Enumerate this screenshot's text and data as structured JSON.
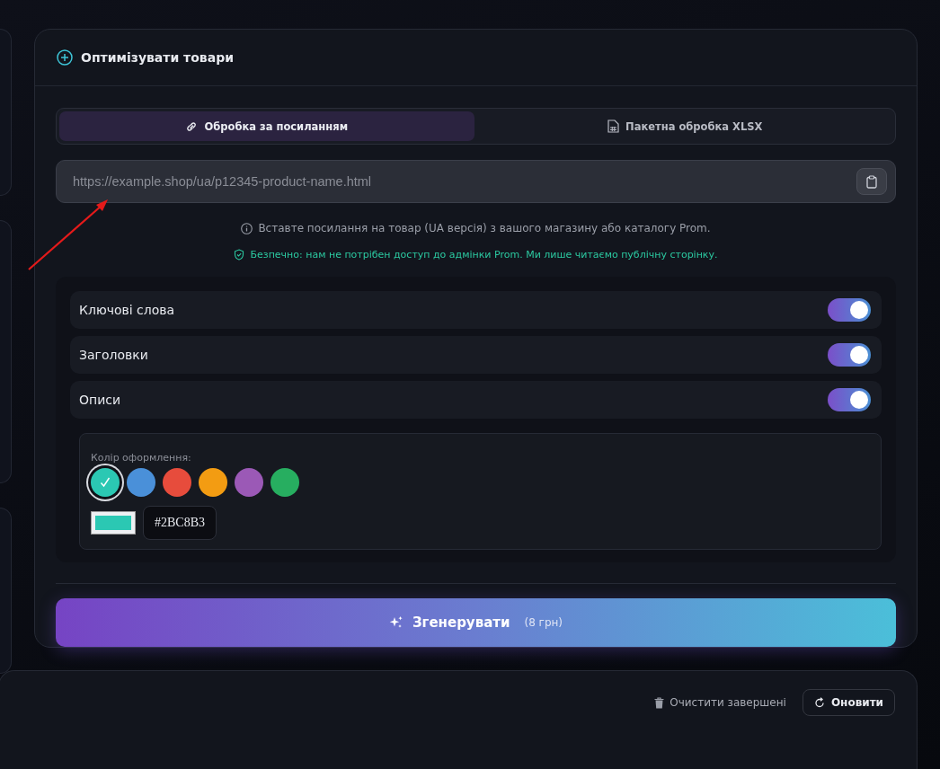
{
  "panel": {
    "title": "Оптимізувати товари"
  },
  "tabs": [
    {
      "label": "Обробка за посиланням",
      "kind": "link",
      "selected": true
    },
    {
      "label": "Пакетна обробка XLSX",
      "kind": "file",
      "selected": false
    }
  ],
  "url_field": {
    "placeholder": "https://example.shop/ua/p12345-product-name.html"
  },
  "hint": "Вставте посилання на товар (UA версія) з вашого магазину або каталогу Prom.",
  "safety_note": "Безпечно: нам не потрібен доступ до адмінки Prom. Ми лише читаємо публічну сторінку.",
  "options": [
    {
      "label": "Ключові слова",
      "on": true
    },
    {
      "label": "Заголовки",
      "on": true
    },
    {
      "label": "Описи",
      "on": true
    }
  ],
  "color_picker": {
    "label": "Колір оформлення:",
    "hex_value": "#2BC8B3",
    "swatches": [
      {
        "color": "#2bc8b3",
        "selected": true
      },
      {
        "color": "#4a90d9",
        "selected": false
      },
      {
        "color": "#e74c3c",
        "selected": false
      },
      {
        "color": "#f39c12",
        "selected": false
      },
      {
        "color": "#9b59b6",
        "selected": false
      },
      {
        "color": "#27ae60",
        "selected": false
      }
    ]
  },
  "generate_button": {
    "label": "Згенерувати",
    "price": "(8 грн)"
  },
  "queue_toolbar": {
    "clear_button": "Очистити завершені",
    "refresh_button": "Оновити"
  }
}
